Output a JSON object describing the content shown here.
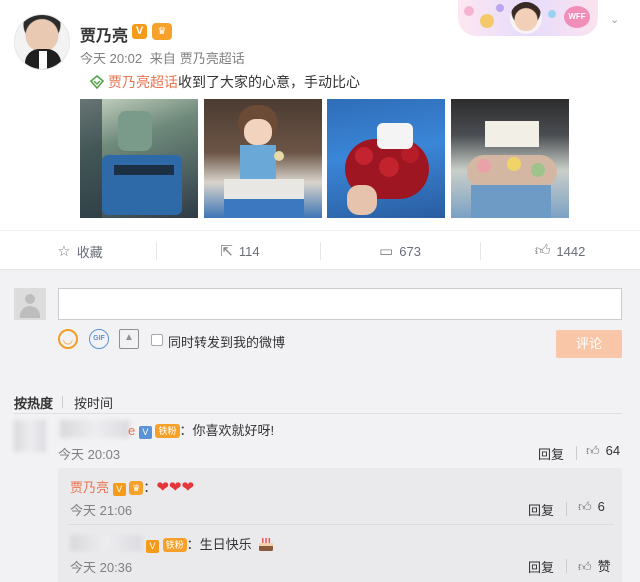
{
  "post": {
    "author": "贾乃亮",
    "v_badge": "V",
    "crown_badge": "♛",
    "time": "今天 20:02",
    "source_prefix": "来自",
    "source": "贾乃亮超话",
    "topic": "贾乃亮超话",
    "text": "收到了大家的心意，手动比心",
    "banner_badge": "WFF"
  },
  "actions": {
    "favorite": "收藏",
    "repost": "114",
    "comment": "673",
    "like": "1442"
  },
  "composer": {
    "forward_label": "同时转发到我的微博",
    "submit": "评论",
    "gif_label": "GIF"
  },
  "sort": {
    "hot": "按热度",
    "time": "按时间"
  },
  "comments": [
    {
      "user_suffix": "e",
      "badge": "铁粉",
      "text": "：你喜欢就好呀!",
      "time": "今天 20:03",
      "reply": "回复",
      "likes": "64"
    }
  ],
  "replies": [
    {
      "user": "贾乃亮",
      "text": "：",
      "hearts": "❤❤❤",
      "time": "今天 21:06",
      "reply": "回复",
      "likes": "6"
    },
    {
      "badge": "铁粉",
      "text": "：生日快乐",
      "time": "今天 20:36",
      "reply": "回复",
      "likes": "赞"
    }
  ]
}
